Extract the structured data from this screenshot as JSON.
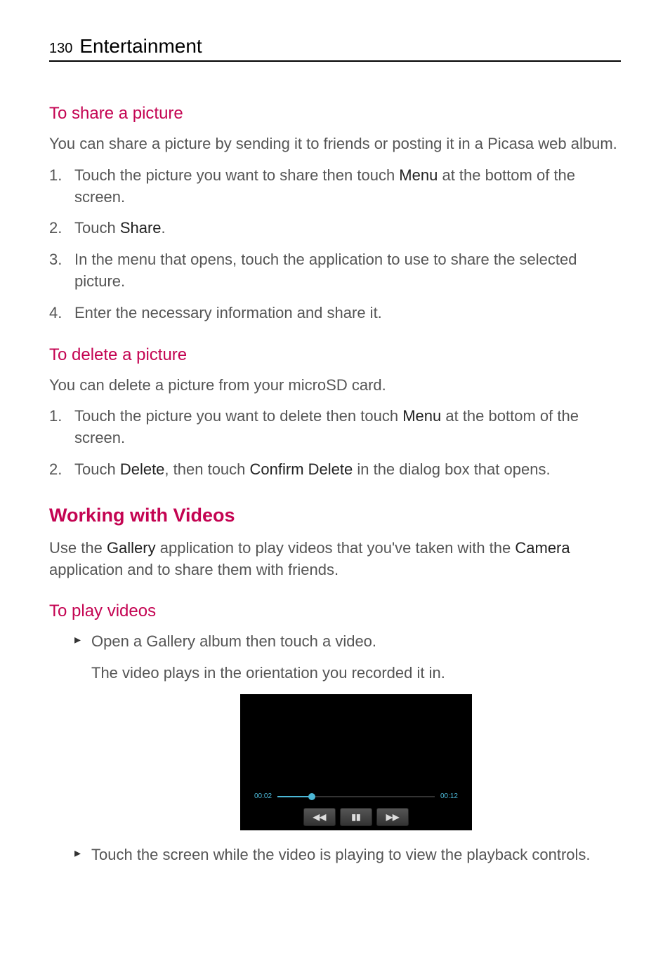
{
  "header": {
    "page_number": "130",
    "chapter_title": "Entertainment"
  },
  "section_share": {
    "heading": "To share a picture",
    "intro": "You can share a picture by sending it to friends or posting it in a Picasa web album.",
    "steps": {
      "s1_a": "Touch the picture you want to share then touch ",
      "s1_b": "Menu",
      "s1_c": " at the bottom of the screen.",
      "s2_a": "Touch ",
      "s2_b": "Share",
      "s2_c": ".",
      "s3": "In the menu that opens, touch the application to use to share the selected picture.",
      "s4": "Enter the necessary information and share it."
    }
  },
  "section_delete": {
    "heading": "To delete a picture",
    "intro": "You can delete a picture from your microSD card.",
    "steps": {
      "s1_a": "Touch the picture you want to delete then touch ",
      "s1_b": "Menu",
      "s1_c": " at the bottom of the screen.",
      "s2_a": "Touch ",
      "s2_b": "Delete",
      "s2_c": ", then touch ",
      "s2_d": "Confirm Delete",
      "s2_e": " in the dialog box that opens."
    }
  },
  "section_videos": {
    "heading": "Working with Videos",
    "intro_a": "Use the ",
    "intro_b": "Gallery",
    "intro_c": " application to play videos that you've taken with the ",
    "intro_d": "Camera",
    "intro_e": " application and to share them with friends.",
    "sub_heading": "To play videos",
    "bullet1": "Open a Gallery album then touch a video.",
    "bullet1_sub": "The video plays in the orientation you recorded it in.",
    "bullet2": "Touch the screen while the video is playing to view the playback controls."
  },
  "video_player": {
    "elapsed": "00:02",
    "duration": "00:12",
    "rewind_glyph": "◀◀",
    "pause_glyph": "▮▮",
    "forward_glyph": "▶▶"
  }
}
